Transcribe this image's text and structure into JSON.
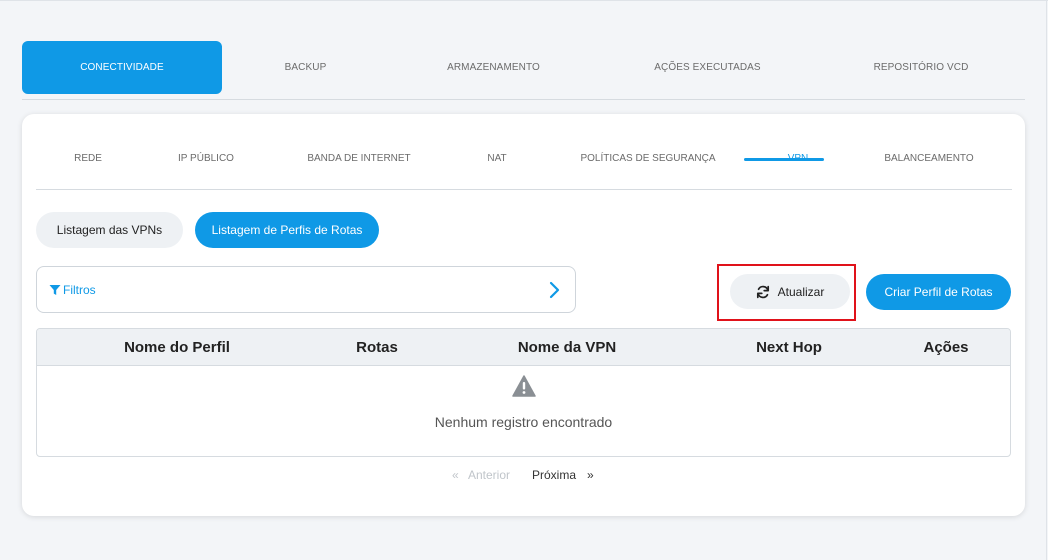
{
  "main_tabs": [
    {
      "label": "CONECTIVIDADE",
      "active": true
    },
    {
      "label": "BACKUP",
      "active": false
    },
    {
      "label": "ARMAZENAMENTO",
      "active": false
    },
    {
      "label": "AÇÕES EXECUTADAS",
      "active": false
    },
    {
      "label": "REPOSITÓRIO VCD",
      "active": false
    }
  ],
  "sub_tabs": [
    {
      "label": "REDE"
    },
    {
      "label": "IP PÚBLICO"
    },
    {
      "label": "BANDA DE INTERNET"
    },
    {
      "label": "NAT"
    },
    {
      "label": "POLÍTICAS DE SEGURANÇA"
    },
    {
      "label": "VPN",
      "active": true
    },
    {
      "label": "BALANCEAMENTO"
    }
  ],
  "pills": {
    "vpn_list": "Listagem das VPNs",
    "route_profiles": "Listagem de Perfis de Rotas"
  },
  "filter": {
    "label": "Filtros"
  },
  "actions": {
    "refresh": "Atualizar",
    "create": "Criar Perfil de Rotas"
  },
  "table": {
    "columns": [
      "Nome do Perfil",
      "Rotas",
      "Nome da VPN",
      "Next Hop",
      "Ações"
    ],
    "rows": [],
    "empty_message": "Nenhum registro encontrado"
  },
  "pagination": {
    "prev_symbol": "«",
    "prev_label": "Anterior",
    "next_label": "Próxima",
    "next_symbol": "»"
  },
  "colors": {
    "accent": "#0f99e6",
    "highlight": "#e0121a",
    "background": "#f3f5f8"
  }
}
